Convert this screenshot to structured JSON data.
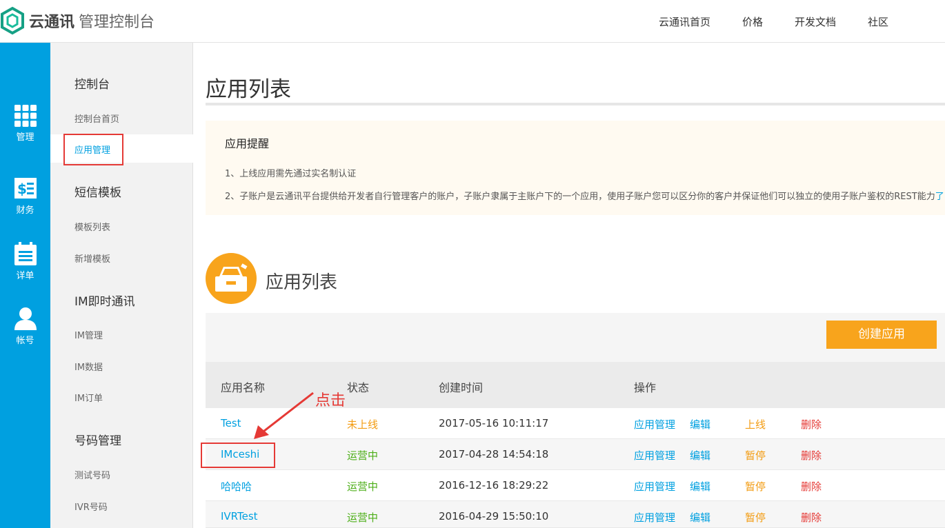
{
  "header": {
    "brand": "云通讯",
    "subtitle": "管理控制台",
    "nav": [
      "云通讯首页",
      "价格",
      "开发文档",
      "社区"
    ]
  },
  "iconbar": {
    "items": [
      {
        "label": "管理",
        "icon": "grid-icon"
      },
      {
        "label": "财务",
        "icon": "bill-icon"
      },
      {
        "label": "详单",
        "icon": "calendar-list-icon"
      },
      {
        "label": "帐号",
        "icon": "user-icon"
      }
    ]
  },
  "sidebar": {
    "sections": [
      {
        "title": "控制台",
        "items": [
          "控制台首页",
          "应用管理"
        ]
      },
      {
        "title": "短信模板",
        "items": [
          "模板列表",
          "新增模板"
        ]
      },
      {
        "title": "IM即时通讯",
        "items": [
          "IM管理",
          "IM数据",
          "IM订单"
        ]
      },
      {
        "title": "号码管理",
        "items": [
          "测试号码",
          "IVR号码"
        ]
      }
    ],
    "active": "应用管理"
  },
  "main": {
    "page_title": "应用列表",
    "notice": {
      "title": "应用提醒",
      "line1": "1、上线应用需先通过实名制认证",
      "line2": "2、子账户是云通讯平台提供给开发者自行管理客户的账户，子账户隶属于主账户下的一个应用，使用子账户您可以区分你的客户并保证他们可以独立的使用子账户鉴权的REST能力",
      "line2_link": "了"
    },
    "list_title": "应用列表",
    "create_button": "创建应用",
    "columns": [
      "应用名称",
      "状态",
      "创建时间",
      "操作"
    ],
    "rows": [
      {
        "name": "Test",
        "status": "未上线",
        "created": "2017-05-16 10:11:17",
        "ops": [
          "应用管理",
          "编辑",
          "上线",
          "删除"
        ]
      },
      {
        "name": "IMceshi",
        "status": "运营中",
        "created": "2017-04-28 14:54:18",
        "ops": [
          "应用管理",
          "编辑",
          "暂停",
          "删除"
        ]
      },
      {
        "name": "哈哈哈",
        "status": "运营中",
        "created": "2016-12-16 18:29:22",
        "ops": [
          "应用管理",
          "编辑",
          "暂停",
          "删除"
        ]
      },
      {
        "name": "IVRTest",
        "status": "运营中",
        "created": "2016-04-29 15:50:10",
        "ops": [
          "应用管理",
          "编辑",
          "暂停",
          "删除"
        ]
      }
    ]
  },
  "annotation": {
    "text": "点击"
  },
  "colors": {
    "accent": "#00a0e0",
    "orange": "#f8a41c",
    "green": "#4cae17",
    "red": "#e53935"
  }
}
